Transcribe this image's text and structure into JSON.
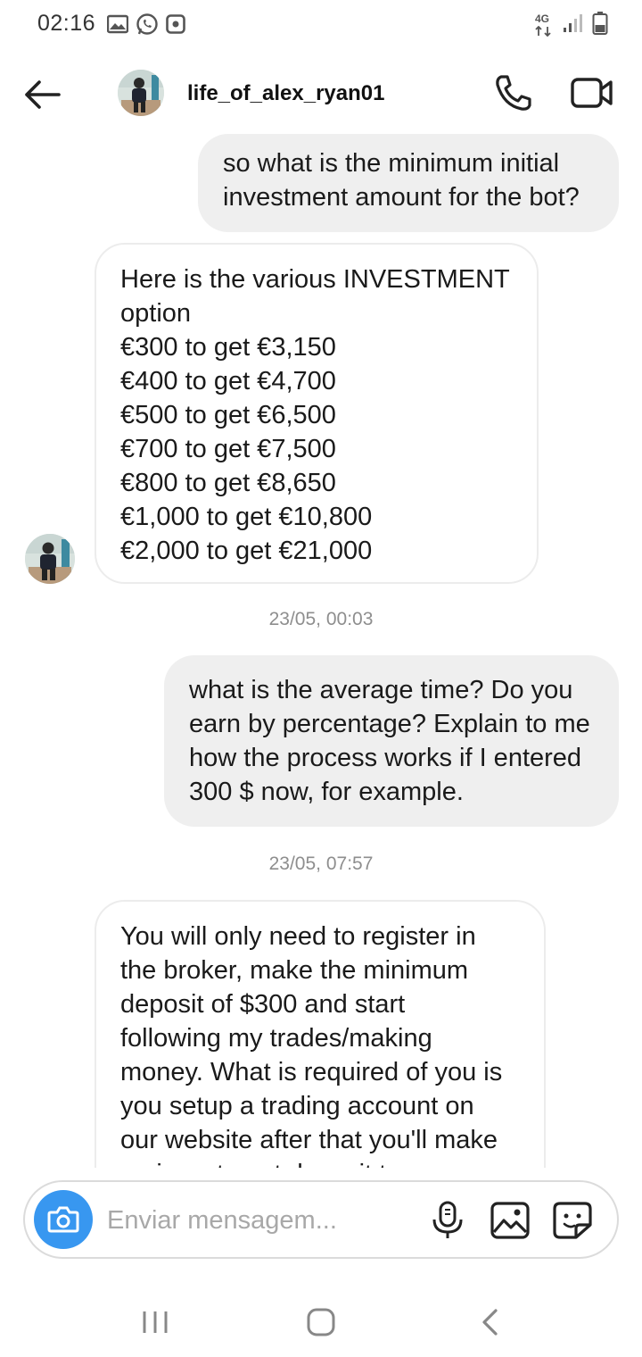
{
  "status_bar": {
    "time": "02:16",
    "network": "4G",
    "icons_left": [
      "gallery-icon",
      "whatsapp-icon",
      "app-notification-icon"
    ],
    "icons_right": [
      "network-4g-icon",
      "signal-icon",
      "battery-icon"
    ]
  },
  "header": {
    "username": "life_of_alex_ryan01",
    "icons": [
      "back-arrow-icon",
      "phone-icon",
      "video-camera-icon"
    ]
  },
  "messages": [
    {
      "direction": "outgoing",
      "lines": [
        "so what is the minimum initial",
        "investment amount for the bot?"
      ]
    },
    {
      "direction": "incoming",
      "lines": [
        "Here is the various INVESTMENT",
        "option",
        "€300 to get €3,150",
        "€400 to get €4,700",
        "€500 to get €6,500",
        "€700 to get €7,500",
        "€800 to get €8,650",
        "€1,000 to get €10,800",
        "€2,000 to get €21,000"
      ]
    },
    {
      "direction": "outgoing",
      "lines": [
        "what is the average time? Do you",
        "earn by percentage? Explain to me",
        "how the process works if I entered",
        "300 $ now, for example."
      ]
    },
    {
      "direction": "incoming",
      "lines": [
        "You will only need to register in",
        "the broker, make the minimum",
        "deposit of $300 and start",
        "following my trades/making",
        "money. What is required of you is",
        "you setup a trading account on",
        "our website after that you'll make",
        "an investment deposit to your"
      ]
    }
  ],
  "timestamps": [
    "23/05, 00:03",
    "23/05, 07:57"
  ],
  "composer": {
    "placeholder": "Enviar mensagem...",
    "icons": [
      "camera-icon",
      "microphone-icon",
      "gallery-icon",
      "sticker-icon"
    ]
  },
  "nav_bar": {
    "icons": [
      "recent-apps-icon",
      "home-icon",
      "back-icon"
    ]
  },
  "colors": {
    "accent": "#3897f0",
    "outgoing_bubble": "#efefef",
    "incoming_border": "#ececec",
    "timestamp": "#8e8e8e"
  }
}
